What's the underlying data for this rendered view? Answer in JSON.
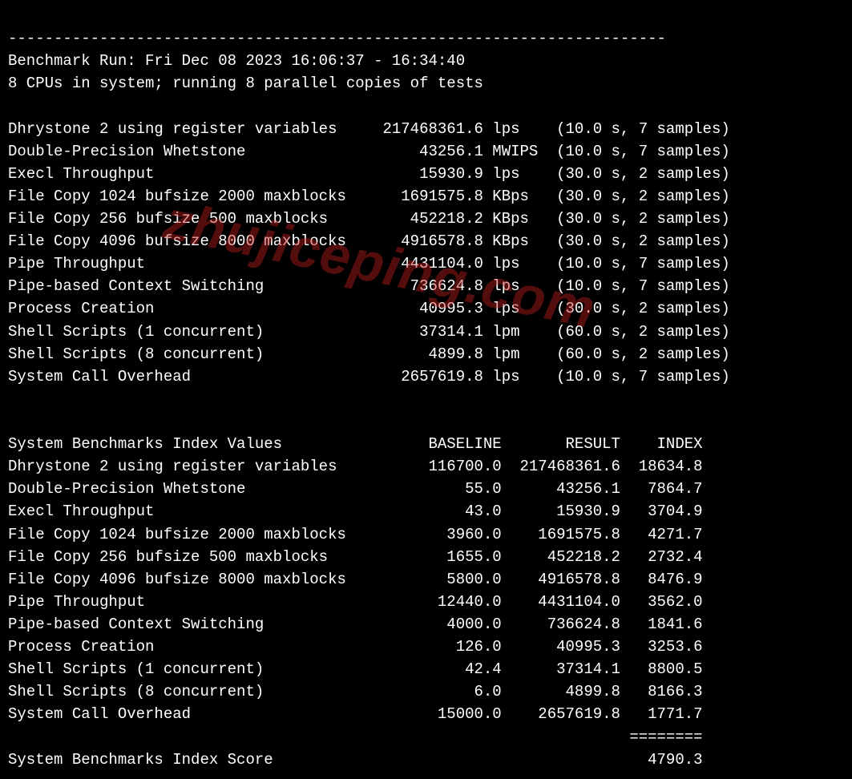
{
  "divider": "------------------------------------------------------------------------",
  "run_line": "Benchmark Run: Fri Dec 08 2023 16:06:37 - 16:34:40",
  "cpu_line": "8 CPUs in system; running 8 parallel copies of tests",
  "results": [
    {
      "name": "Dhrystone 2 using register variables",
      "value": "217468361.6",
      "unit": "lps",
      "time": "10.0",
      "samples": "7"
    },
    {
      "name": "Double-Precision Whetstone",
      "value": "43256.1",
      "unit": "MWIPS",
      "time": "10.0",
      "samples": "7"
    },
    {
      "name": "Execl Throughput",
      "value": "15930.9",
      "unit": "lps",
      "time": "30.0",
      "samples": "2"
    },
    {
      "name": "File Copy 1024 bufsize 2000 maxblocks",
      "value": "1691575.8",
      "unit": "KBps",
      "time": "30.0",
      "samples": "2"
    },
    {
      "name": "File Copy 256 bufsize 500 maxblocks",
      "value": "452218.2",
      "unit": "KBps",
      "time": "30.0",
      "samples": "2"
    },
    {
      "name": "File Copy 4096 bufsize 8000 maxblocks",
      "value": "4916578.8",
      "unit": "KBps",
      "time": "30.0",
      "samples": "2"
    },
    {
      "name": "Pipe Throughput",
      "value": "4431104.0",
      "unit": "lps",
      "time": "10.0",
      "samples": "7"
    },
    {
      "name": "Pipe-based Context Switching",
      "value": "736624.8",
      "unit": "lps",
      "time": "10.0",
      "samples": "7"
    },
    {
      "name": "Process Creation",
      "value": "40995.3",
      "unit": "lps",
      "time": "30.0",
      "samples": "2"
    },
    {
      "name": "Shell Scripts (1 concurrent)",
      "value": "37314.1",
      "unit": "lpm",
      "time": "60.0",
      "samples": "2"
    },
    {
      "name": "Shell Scripts (8 concurrent)",
      "value": "4899.8",
      "unit": "lpm",
      "time": "60.0",
      "samples": "2"
    },
    {
      "name": "System Call Overhead",
      "value": "2657619.8",
      "unit": "lps",
      "time": "10.0",
      "samples": "7"
    }
  ],
  "index_header": {
    "title": "System Benchmarks Index Values",
    "col1": "BASELINE",
    "col2": "RESULT",
    "col3": "INDEX"
  },
  "index_rows": [
    {
      "name": "Dhrystone 2 using register variables",
      "baseline": "116700.0",
      "result": "217468361.6",
      "index": "18634.8"
    },
    {
      "name": "Double-Precision Whetstone",
      "baseline": "55.0",
      "result": "43256.1",
      "index": "7864.7"
    },
    {
      "name": "Execl Throughput",
      "baseline": "43.0",
      "result": "15930.9",
      "index": "3704.9"
    },
    {
      "name": "File Copy 1024 bufsize 2000 maxblocks",
      "baseline": "3960.0",
      "result": "1691575.8",
      "index": "4271.7"
    },
    {
      "name": "File Copy 256 bufsize 500 maxblocks",
      "baseline": "1655.0",
      "result": "452218.2",
      "index": "2732.4"
    },
    {
      "name": "File Copy 4096 bufsize 8000 maxblocks",
      "baseline": "5800.0",
      "result": "4916578.8",
      "index": "8476.9"
    },
    {
      "name": "Pipe Throughput",
      "baseline": "12440.0",
      "result": "4431104.0",
      "index": "3562.0"
    },
    {
      "name": "Pipe-based Context Switching",
      "baseline": "4000.0",
      "result": "736624.8",
      "index": "1841.6"
    },
    {
      "name": "Process Creation",
      "baseline": "126.0",
      "result": "40995.3",
      "index": "3253.6"
    },
    {
      "name": "Shell Scripts (1 concurrent)",
      "baseline": "42.4",
      "result": "37314.1",
      "index": "8800.5"
    },
    {
      "name": "Shell Scripts (8 concurrent)",
      "baseline": "6.0",
      "result": "4899.8",
      "index": "8166.3"
    },
    {
      "name": "System Call Overhead",
      "baseline": "15000.0",
      "result": "2657619.8",
      "index": "1771.7"
    }
  ],
  "score_separator": "========",
  "score_label": "System Benchmarks Index Score",
  "score_value": "4790.3",
  "watermark": "zhujiceping.com"
}
